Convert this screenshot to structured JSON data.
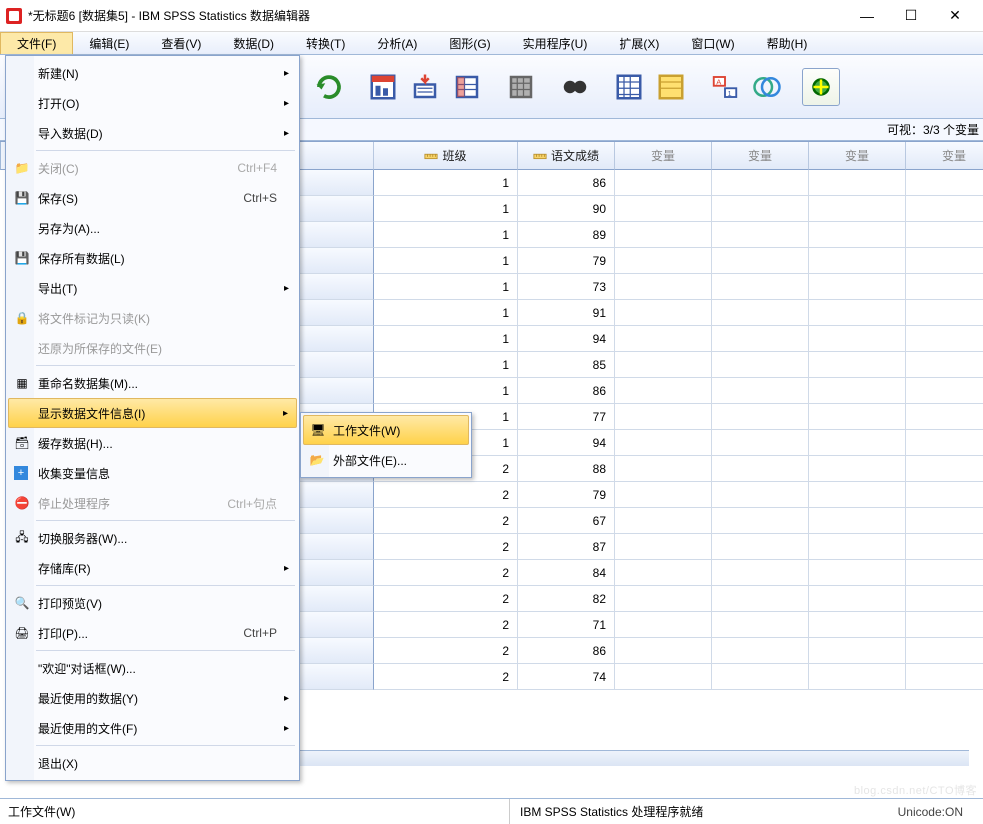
{
  "window": {
    "title": "*无标题6 [数据集5] - IBM SPSS Statistics 数据编辑器",
    "min": "—",
    "max": "☐",
    "close": "✕"
  },
  "menubar": [
    "文件(F)",
    "编辑(E)",
    "查看(V)",
    "数据(D)",
    "转换(T)",
    "分析(A)",
    "图形(G)",
    "实用程序(U)",
    "扩展(X)",
    "窗口(W)",
    "帮助(H)"
  ],
  "visible": {
    "label": "可视：",
    "value": "3/3 个变量"
  },
  "columns": {
    "c1": "班级",
    "c2": "语文成绩",
    "empty": "变量"
  },
  "rows": {
    "col1": [
      1,
      1,
      1,
      1,
      1,
      1,
      1,
      1,
      1,
      1,
      1,
      2,
      2,
      2,
      2,
      2,
      2,
      2,
      2,
      2
    ],
    "col2": [
      86,
      90,
      89,
      79,
      73,
      91,
      94,
      85,
      86,
      77,
      94,
      88,
      79,
      67,
      87,
      84,
      82,
      71,
      86,
      74
    ]
  },
  "file_menu": {
    "new": "新建(N)",
    "open": "打开(O)",
    "import": "导入数据(D)",
    "close": "关闭(C)",
    "close_sc": "Ctrl+F4",
    "save": "保存(S)",
    "save_sc": "Ctrl+S",
    "saveas": "另存为(A)...",
    "saveall": "保存所有数据(L)",
    "export": "导出(T)",
    "readonly": "将文件标记为只读(K)",
    "revert": "还原为所保存的文件(E)",
    "rename": "重命名数据集(M)...",
    "showinfo": "显示数据文件信息(I)",
    "cache": "缓存数据(H)...",
    "collect": "收集变量信息",
    "stop": "停止处理程序",
    "stop_sc": "Ctrl+句点",
    "switch": "切换服务器(W)...",
    "repo": "存储库(R)",
    "preview": "打印预览(V)",
    "print": "打印(P)...",
    "print_sc": "Ctrl+P",
    "welcome": "\"欢迎\"对话框(W)...",
    "recent_data": "最近使用的数据(Y)",
    "recent_files": "最近使用的文件(F)",
    "exit": "退出(X)"
  },
  "submenu": {
    "work": "工作文件(W)",
    "ext": "外部文件(E)..."
  },
  "status": {
    "left": "工作文件(W)",
    "mid": "IBM SPSS Statistics 处理程序就绪",
    "right": "Unicode:ON"
  },
  "watermark": "blog.csdn.net/CTO博客"
}
